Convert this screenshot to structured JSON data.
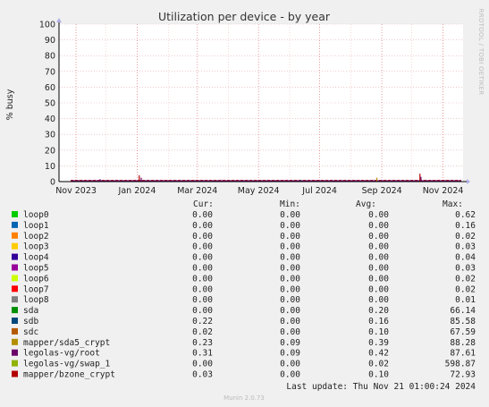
{
  "title": "Utilization per device - by year",
  "ylabel": "% busy",
  "side_label": "RRDTOOL / TOBI OETIKER",
  "legend_headers": {
    "cur": "Cur:",
    "min": "Min:",
    "avg": "Avg:",
    "max": "Max:"
  },
  "footer": {
    "last_update": "Last update: Thu Nov 21 01:00:24 2024",
    "version": "Munin 2.0.73"
  },
  "chart_data": {
    "type": "line",
    "title": "Utilization per device - by year",
    "ylabel": "% busy",
    "ylim": [
      0,
      100
    ],
    "yticks": [
      0,
      10,
      20,
      30,
      40,
      50,
      60,
      70,
      80,
      90,
      100
    ],
    "grid": true,
    "xlim": [
      "2023-10-15",
      "2024-11-21"
    ],
    "xticks": [
      {
        "label": "Nov 2023",
        "date": "2023-11-01"
      },
      {
        "label": "Jan 2024",
        "date": "2024-01-01"
      },
      {
        "label": "Mar 2024",
        "date": "2024-03-01"
      },
      {
        "label": "May 2024",
        "date": "2024-05-01"
      },
      {
        "label": "Jul 2024",
        "date": "2024-07-01"
      },
      {
        "label": "Sep 2024",
        "date": "2024-09-01"
      },
      {
        "label": "Nov 2024",
        "date": "2024-11-01"
      }
    ],
    "series": [
      {
        "name": "loop0",
        "color": "#00cc00",
        "cur": "0.00",
        "min": "0.00",
        "avg": "0.00",
        "max": "0.62"
      },
      {
        "name": "loop1",
        "color": "#0066b3",
        "cur": "0.00",
        "min": "0.00",
        "avg": "0.00",
        "max": "0.16"
      },
      {
        "name": "loop2",
        "color": "#ff8000",
        "cur": "0.00",
        "min": "0.00",
        "avg": "0.00",
        "max": "0.02"
      },
      {
        "name": "loop3",
        "color": "#ffcc00",
        "cur": "0.00",
        "min": "0.00",
        "avg": "0.00",
        "max": "0.03"
      },
      {
        "name": "loop4",
        "color": "#330099",
        "cur": "0.00",
        "min": "0.00",
        "avg": "0.00",
        "max": "0.04"
      },
      {
        "name": "loop5",
        "color": "#990099",
        "cur": "0.00",
        "min": "0.00",
        "avg": "0.00",
        "max": "0.03"
      },
      {
        "name": "loop6",
        "color": "#ccff00",
        "cur": "0.00",
        "min": "0.00",
        "avg": "0.00",
        "max": "0.02"
      },
      {
        "name": "loop7",
        "color": "#ff0000",
        "cur": "0.00",
        "min": "0.00",
        "avg": "0.00",
        "max": "0.02"
      },
      {
        "name": "loop8",
        "color": "#808080",
        "cur": "0.00",
        "min": "0.00",
        "avg": "0.00",
        "max": "0.01"
      },
      {
        "name": "sda",
        "color": "#008f00",
        "cur": "0.00",
        "min": "0.00",
        "avg": "0.20",
        "max": "66.14"
      },
      {
        "name": "sdb",
        "color": "#00487d",
        "cur": "0.22",
        "min": "0.00",
        "avg": "0.16",
        "max": "85.58"
      },
      {
        "name": "sdc",
        "color": "#b35a00",
        "cur": "0.02",
        "min": "0.00",
        "avg": "0.10",
        "max": "67.59"
      },
      {
        "name": "mapper/sda5_crypt",
        "color": "#b38f00",
        "cur": "0.23",
        "min": "0.09",
        "avg": "0.39",
        "max": "88.28"
      },
      {
        "name": "legolas-vg/root",
        "color": "#6b006b",
        "cur": "0.31",
        "min": "0.09",
        "avg": "0.42",
        "max": "87.61"
      },
      {
        "name": "legolas-vg/swap_1",
        "color": "#8fb300",
        "cur": "0.00",
        "min": "0.00",
        "avg": "0.02",
        "max": "598.87"
      },
      {
        "name": "mapper/bzone_crypt",
        "color": "#b30000",
        "cur": "0.03",
        "min": "0.00",
        "avg": "0.10",
        "max": "72.93"
      }
    ],
    "spikes": [
      {
        "date": "2023-11-25",
        "value": 1.5,
        "color": "#6b006b"
      },
      {
        "date": "2024-01-03",
        "value": 4.0,
        "color": "#b30000"
      },
      {
        "date": "2024-01-05",
        "value": 2.5,
        "color": "#6b006b"
      },
      {
        "date": "2024-06-12",
        "value": 1.0,
        "color": "#00487d"
      },
      {
        "date": "2024-08-27",
        "value": 2.5,
        "color": "#b38f00"
      },
      {
        "date": "2024-10-09",
        "value": 5.0,
        "color": "#b30000"
      },
      {
        "date": "2024-10-10",
        "value": 3.0,
        "color": "#6b006b"
      }
    ]
  }
}
